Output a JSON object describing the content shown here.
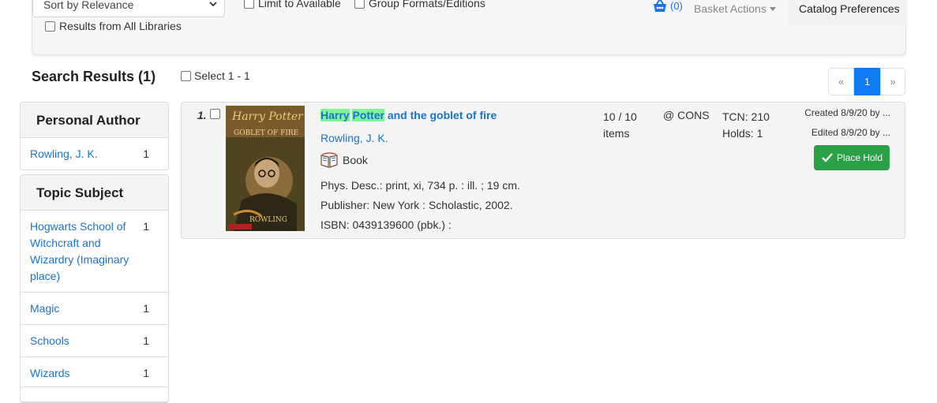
{
  "toolbar": {
    "sort_value": "Sort by Relevance",
    "limit_available_label": "Limit to Available",
    "group_formats_label": "Group Formats/Editions",
    "all_libraries_label": "Results from All Libraries",
    "basket_count": "(0)",
    "basket_actions_label": "Basket Actions",
    "catalog_prefs_label": "Catalog Preferences"
  },
  "results": {
    "title": "Search Results (1)",
    "select_label": "Select 1 - 1"
  },
  "pager": {
    "prev": "«",
    "current": "1",
    "next": "»"
  },
  "facets": [
    {
      "heading": "Personal Author",
      "items": [
        {
          "name": "Rowling, J. K.",
          "count": "1"
        }
      ]
    },
    {
      "heading": "Topic Subject",
      "items": [
        {
          "name": "Hogwarts School of Witchcraft and Wizardry (Imaginary place)",
          "count": "1"
        },
        {
          "name": "Magic",
          "count": "1"
        },
        {
          "name": "Schools",
          "count": "1"
        },
        {
          "name": "Wizards",
          "count": "1"
        }
      ]
    }
  ],
  "record": {
    "number": "1.",
    "title_hl1": "Harry",
    "title_hl2": "Potter",
    "title_rest": "and the goblet of fire",
    "author": "Rowling, J. K.",
    "format": "Book",
    "phys_desc": "Phys. Desc.: print, xi, 734 p. : ill. ; 19 cm.",
    "publisher": "Publisher: New York : Scholastic, 2002.",
    "isbn": "ISBN: 0439139600 (pbk.) :",
    "items_line1": "10 / 10",
    "items_line2": "items",
    "org": "@ CONS",
    "tcn": "TCN: 210",
    "holds": "Holds: 1",
    "created": "Created 8/9/20 by ...",
    "edited": "Edited 8/9/20 by ...",
    "place_hold_label": "Place Hold",
    "cover_text_top": "Harry Potter",
    "cover_text_mid": "GOBLET OF FIRE",
    "cover_text_bottom": "ROWLING"
  }
}
